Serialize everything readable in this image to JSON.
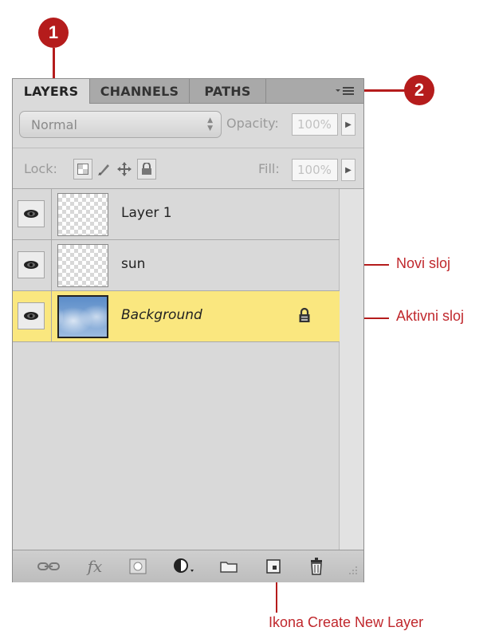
{
  "callouts": {
    "one": "1",
    "two": "2"
  },
  "annotations": {
    "new_layer": "Novi sloj",
    "active_layer": "Aktivni sloj",
    "create_icon": "Ikona Create New Layer"
  },
  "panel": {
    "tabs": [
      {
        "label": "LAYERS",
        "active": true
      },
      {
        "label": "CHANNELS",
        "active": false
      },
      {
        "label": "PATHS",
        "active": false
      }
    ],
    "menu_icon": "panel-menu-icon",
    "blend_mode": "Normal",
    "opacity_label": "Opacity:",
    "opacity_value": "100%",
    "lock_label": "Lock:",
    "fill_label": "Fill:",
    "fill_value": "100%"
  },
  "layers": [
    {
      "name": "Layer 1",
      "visible": true,
      "active": false,
      "locked": false
    },
    {
      "name": "sun",
      "visible": true,
      "active": false,
      "locked": false
    },
    {
      "name": "Background",
      "visible": true,
      "active": true,
      "locked": true
    }
  ],
  "bottom_icons": [
    "link-layers-icon",
    "fx-icon",
    "add-mask-icon",
    "adjustment-layer-icon",
    "new-group-icon",
    "create-new-layer-icon",
    "delete-layer-icon"
  ],
  "colors": {
    "callout_red": "#b51c1c",
    "active_layer": "#fae77f"
  }
}
